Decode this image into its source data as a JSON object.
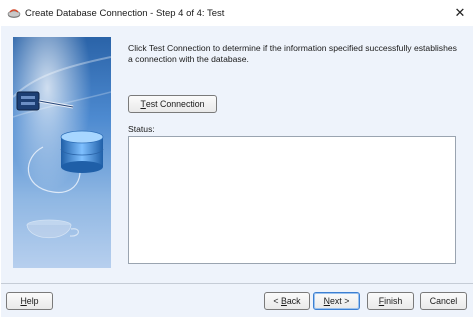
{
  "window": {
    "title": "Create Database Connection - Step 4 of 4: Test",
    "close_glyph": "✕"
  },
  "content": {
    "instructions": "Click Test Connection to determine if the information specified successfully establishes a connection with the database.",
    "test_button": {
      "prefix": "",
      "mnemonic": "T",
      "rest": "est Connection"
    },
    "status_label": "Status:",
    "status_text": ""
  },
  "footer": {
    "help": {
      "mnemonic": "H",
      "rest": "elp"
    },
    "back": {
      "prefix": "< ",
      "mnemonic": "B",
      "rest": "ack"
    },
    "next": {
      "prefix": "",
      "mnemonic": "N",
      "rest": "ext >"
    },
    "finish": {
      "mnemonic": "F",
      "rest": "inish"
    },
    "cancel": {
      "label": "Cancel"
    }
  },
  "icons": {
    "app": "database-wizard-icon",
    "side": "database-connection-illustration"
  },
  "colors": {
    "client_bg": "#eef3fb",
    "accent_default_button": "#3c7fd1",
    "side_panel_top": "#2a63a8"
  }
}
